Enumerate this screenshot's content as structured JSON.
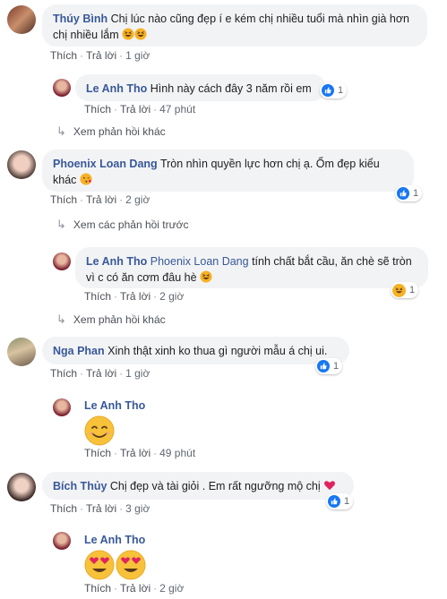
{
  "comments": [
    {
      "name": "Thúy Bình",
      "text": "Chị lúc nào cũng đẹp í e kém chị nhiều tuổi mà nhìn già hơn chị nhiều lắm",
      "like": "Thích",
      "reply": "Trả lời",
      "time": "1 giờ"
    },
    {
      "name": "Le Anh Tho",
      "text": "Hình này cách đây 3 năm rồi em",
      "like": "Thích",
      "reply": "Trả lời",
      "time": "47 phút",
      "reaction_count": "1"
    },
    {
      "more": "Xem phản hồi khác"
    },
    {
      "name": "Phoenix Loan Dang",
      "text": "Tròn nhìn quyền lực hơn chị ạ. Ốm đẹp kiểu khác",
      "like": "Thích",
      "reply": "Trả lời",
      "time": "2 giờ",
      "reaction_count": "1"
    },
    {
      "more": "Xem các phản hồi trước"
    },
    {
      "name": "Le Anh Tho",
      "tag": "Phoenix Loan Dang",
      "text": "tính chất bắt cầu, ăn chè sẽ tròn vì c có ăn cơm đâu hè",
      "like": "Thích",
      "reply": "Trả lời",
      "time": "2 giờ",
      "reaction_count": "1"
    },
    {
      "more": "Xem phản hồi khác"
    },
    {
      "name": "Nga Phan",
      "text": "Xinh thật xinh ko thua gì người mẫu á chị ui.",
      "like": "Thích",
      "reply": "Trả lời",
      "time": "1 giờ",
      "reaction_count": "1"
    },
    {
      "name": "Le Anh Tho",
      "like": "Thích",
      "reply": "Trả lời",
      "time": "49 phút"
    },
    {
      "name": "Bích Thủy",
      "text": "Chị đẹp và tài giỏi . Em rất ngưỡng mộ chị",
      "like": "Thích",
      "reply": "Trả lời",
      "time": "3 giờ",
      "reaction_count": "1"
    },
    {
      "name": "Le Anh Tho",
      "like": "Thích",
      "reply": "Trả lời",
      "time": "2 giờ"
    }
  ],
  "colors": {
    "name": "#385898",
    "bubble": "#f2f3f5",
    "like": "#1877f2",
    "emoji": "#f7b125"
  }
}
